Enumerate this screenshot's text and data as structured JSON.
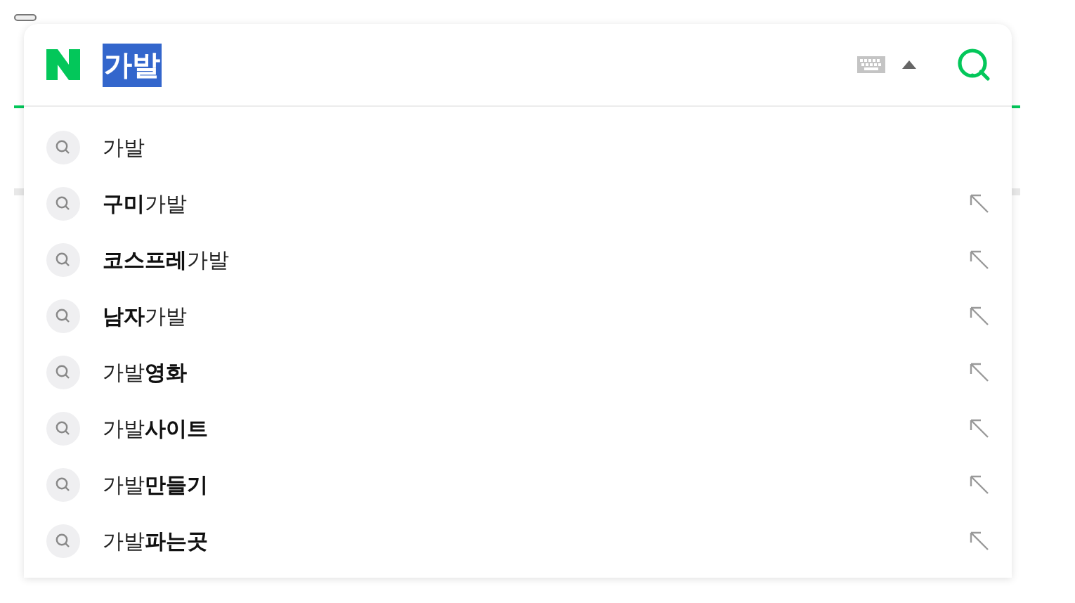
{
  "search": {
    "query": "가발",
    "query_selected": true
  },
  "suggestions": [
    {
      "text": "가발",
      "insert_arrow": false
    },
    {
      "text": "**구미**가발",
      "insert_arrow": true
    },
    {
      "text": "**코스프레**가발",
      "insert_arrow": true
    },
    {
      "text": "**남자**가발",
      "insert_arrow": true
    },
    {
      "text": "가발**영화**",
      "insert_arrow": true
    },
    {
      "text": "가발**사이트**",
      "insert_arrow": true
    },
    {
      "text": "가발**만들기**",
      "insert_arrow": true
    },
    {
      "text": "가발**파는곳**",
      "insert_arrow": true
    }
  ]
}
